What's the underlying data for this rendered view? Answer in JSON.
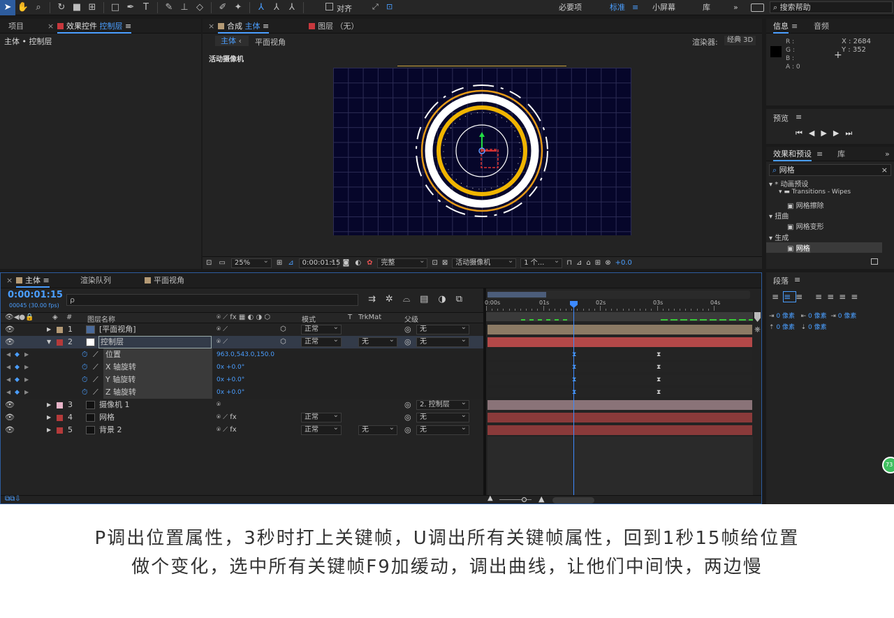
{
  "toolbar": {
    "align_label": "对齐",
    "workspaces": [
      "必要项",
      "标准",
      "小屏幕",
      "库"
    ],
    "search_placeholder": "搜索帮助"
  },
  "project_panel": {
    "tab_project": "项目",
    "tab_effects_prefix": "效果控件",
    "tab_effects_layer": "控制层",
    "breadcrumb": "主体 • 控制层"
  },
  "composition_panel": {
    "tab_comp_prefix": "合成",
    "tab_comp_name": "主体",
    "tab_layer": "图层 （无）",
    "sub_tab_main": "主体",
    "sub_tab_flat": "平面视角",
    "renderer_label": "渲染器:",
    "renderer_value": "经典 3D",
    "camera_label": "活动摄像机",
    "zoom": "25%",
    "timecode": "0:00:01:15",
    "quality": "完整",
    "view": "活动摄像机",
    "views_count": "1 个...",
    "exposure": "+0.0"
  },
  "info_panel": {
    "tab_info": "信息",
    "tab_audio": "音频",
    "r": "R :",
    "g": "G :",
    "b": "B :",
    "a": "A : 0",
    "x": "X : 2684",
    "y": "Y : 352"
  },
  "preview_panel": {
    "title": "预览"
  },
  "effects_panel": {
    "tab_effects": "效果和预设",
    "tab_library": "库",
    "search_value": "网格",
    "tree": [
      {
        "label": "* 动画预设",
        "level": 0
      },
      {
        "label": "Transitions - Wipes",
        "level": 1
      },
      {
        "label": "网格擦除",
        "level": 2
      },
      {
        "label": "扭曲",
        "level": 0
      },
      {
        "label": "网格变形",
        "level": 2
      },
      {
        "label": "生成",
        "level": 0
      },
      {
        "label": "网格",
        "level": 2
      }
    ]
  },
  "paragraph_panel": {
    "title": "段落",
    "indent_values": [
      "0 像素",
      "0 像素",
      "0 像素"
    ],
    "spacing_values": [
      "0 像素",
      "0 像素"
    ]
  },
  "timeline": {
    "tab_main": "主体",
    "tab_render": "渲染队列",
    "tab_flat": "平面视角",
    "timecode": "0:00:01:15",
    "frame_info": "00045 (30.00 fps)",
    "search_placeholder": "ρ",
    "columns": {
      "number": "#",
      "layer_name": "图层名称",
      "mode": "模式",
      "t": "T",
      "trkmat": "TrkMat",
      "parent": "父级"
    },
    "ruler": [
      "0:00s",
      "01s",
      "02s",
      "03s",
      "04s"
    ],
    "layers": [
      {
        "num": "1",
        "name": "[平面视角]",
        "color": "#b49a75",
        "mode": "正常",
        "trkmat": "",
        "parent": "无"
      },
      {
        "num": "2",
        "name": "控制层",
        "color": "#b53a3a",
        "mode": "正常",
        "trkmat": "无",
        "parent": "无"
      },
      {
        "num": "3",
        "name": "摄像机 1",
        "color": "#e7b4c8",
        "mode": "",
        "trkmat": "",
        "parent": "2. 控制层"
      },
      {
        "num": "4",
        "name": "网格",
        "color": "#b53a3a",
        "mode": "正常",
        "trkmat": "",
        "parent": "无"
      },
      {
        "num": "5",
        "name": "背景 2",
        "color": "#b53a3a",
        "mode": "正常",
        "trkmat": "无",
        "parent": "无"
      }
    ],
    "properties": [
      {
        "name": "位置",
        "value": "963.0,543.0,150.0"
      },
      {
        "name": "X 轴旋转",
        "value": "0x +0.0°"
      },
      {
        "name": "Y 轴旋转",
        "value": "0x +0.0°"
      },
      {
        "name": "Z 轴旋转",
        "value": "0x +0.0°"
      }
    ]
  },
  "badge": "73",
  "caption": {
    "line1": "P调出位置属性，3秒时打上关键帧，U调出所有关键帧属性，回到1秒15帧给位置",
    "line2": "做个变化，选中所有关键帧F9加缓动，调出曲线，让他们中间快，两边慢"
  }
}
